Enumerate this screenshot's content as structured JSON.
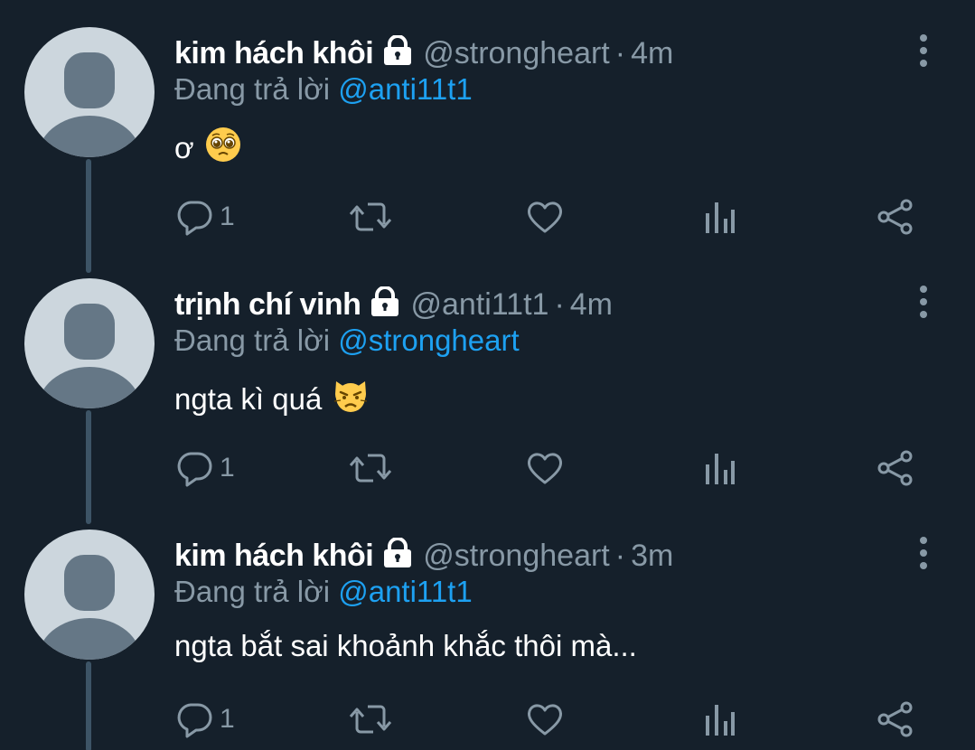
{
  "tweets": [
    {
      "name": "kim hách khôi",
      "handle": "@strongheart",
      "separator": "·",
      "time": "4m",
      "reply_prefix": "Đang trả lời",
      "reply_to": "@anti11t1",
      "text": "ơ",
      "emoji": "pleading-face-emoji",
      "reply_count": "1"
    },
    {
      "name": "trịnh chí vinh",
      "handle": "@anti11t1",
      "separator": "·",
      "time": "4m",
      "reply_prefix": "Đang trả lời",
      "reply_to": "@strongheart",
      "text": "ngta kì quá",
      "emoji": "pouting-cat-emoji",
      "reply_count": "1"
    },
    {
      "name": "kim hách khôi",
      "handle": "@strongheart",
      "separator": "·",
      "time": "3m",
      "reply_prefix": "Đang trả lời",
      "reply_to": "@anti11t1",
      "text": "ngta bắt sai khoảnh khắc thôi mà...",
      "reply_count": "1"
    }
  ],
  "colors": {
    "background": "#15202b",
    "text": "#ffffff",
    "muted": "#8899a6",
    "accent": "#1da1f2",
    "thread_line": "#3d5466",
    "avatar_bg": "#ccd6dd",
    "avatar_fg": "#657786"
  },
  "icons": [
    "lock-icon",
    "more-icon",
    "reply-icon",
    "retweet-icon",
    "like-icon",
    "analytics-icon",
    "share-icon"
  ]
}
